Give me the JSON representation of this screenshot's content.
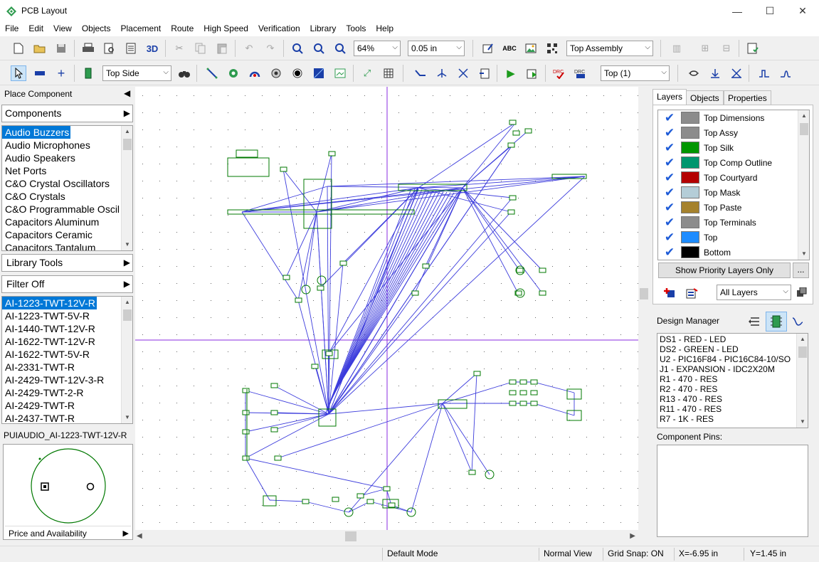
{
  "window": {
    "title": "PCB Layout",
    "minimize": "—",
    "maximize": "☐",
    "close": "✕"
  },
  "menu": [
    "File",
    "Edit",
    "View",
    "Objects",
    "Placement",
    "Route",
    "High Speed",
    "Verification",
    "Library",
    "Tools",
    "Help"
  ],
  "toolbar1": {
    "three_d_label": "3D",
    "zoom_value": "64%",
    "grid_value": "0.05 in",
    "assembly_value": "Top Assembly"
  },
  "toolbar2": {
    "side_value": "Top Side",
    "layer_value": "Top (1)"
  },
  "left_panel": {
    "place_component_title": "Place Component",
    "components_header": "Components",
    "categories": [
      "Audio Buzzers",
      "Audio Microphones",
      "Audio Speakers",
      "Net Ports",
      "C&O Crystal Oscillators",
      "C&O Crystals",
      "C&O Programmable Oscil",
      "Capacitors Aluminum",
      "Capacitors Ceramic",
      "Capacitors Tantalum"
    ],
    "library_tools_header": "Library Tools",
    "filter_header": "Filter Off",
    "parts": [
      "AI-1223-TWT-12V-R",
      "AI-1223-TWT-5V-R",
      "AI-1440-TWT-12V-R",
      "AI-1622-TWT-12V-R",
      "AI-1622-TWT-5V-R",
      "AI-2331-TWT-R",
      "AI-2429-TWT-12V-3-R",
      "AI-2429-TWT-2-R",
      "AI-2429-TWT-R",
      "AI-2437-TWT-R"
    ],
    "preview_name": "PUIAUDIO_AI-1223-TWT-12V-R",
    "price_label": "Price and Availability"
  },
  "right_panel": {
    "tabs": [
      "Layers",
      "Objects",
      "Properties"
    ],
    "layers": [
      {
        "name": "Top Dimensions",
        "color": "#8c8c8c"
      },
      {
        "name": "Top Assy",
        "color": "#8c8c8c"
      },
      {
        "name": "Top Silk",
        "color": "#009600"
      },
      {
        "name": "Top Comp Outline",
        "color": "#00966e"
      },
      {
        "name": "Top Courtyard",
        "color": "#b40000"
      },
      {
        "name": "Top Mask",
        "color": "#b4cdd7"
      },
      {
        "name": "Top Paste",
        "color": "#a5822d"
      },
      {
        "name": "Top Terminals",
        "color": "#8c8c8c"
      },
      {
        "name": "Top",
        "color": "#1e8cff"
      },
      {
        "name": "Bottom",
        "color": "#000000"
      }
    ],
    "priority_button": "Show Priority Layers Only",
    "more_button": "...",
    "all_layers_value": "All Layers",
    "design_manager_title": "Design Manager",
    "design_items": [
      "DS1 - RED - LED",
      "DS2 - GREEN - LED",
      "U2 - PIC16F84 - PIC16C84-10/SO",
      "J1 - EXPANSION - IDC2X20M",
      "R1 - 470 - RES",
      "R2 - 470 - RES",
      "R13 - 470 - RES",
      "R11 - 470 - RES",
      "R7 - 1K - RES"
    ],
    "component_pins_label": "Component Pins:"
  },
  "status": {
    "mode": "Default Mode",
    "view": "Normal View",
    "grid_snap": "Grid Snap: ON",
    "x": "X=-6.95 in",
    "y": "Y=1.45 in"
  },
  "colors": {
    "ratsnest": "#3c3cdc",
    "component": "#007800",
    "crosshair": "#8a2be2",
    "selection": "#0078d7"
  }
}
